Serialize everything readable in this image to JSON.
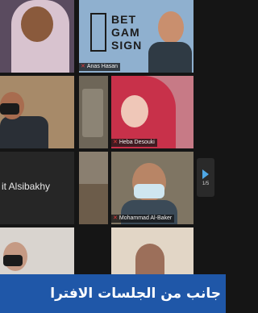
{
  "participants": [
    {
      "name": ""
    },
    {
      "name": "Anas Hasan"
    },
    {
      "name": ""
    },
    {
      "name": ""
    },
    {
      "name": "Heba Desouki"
    },
    {
      "name": "it Alsibakhy"
    },
    {
      "name": "Mohammad Al-Baker"
    },
    {
      "name": ""
    },
    {
      "name": ""
    }
  ],
  "background_logo": {
    "line1": "BET",
    "line2": "GAM",
    "line3": "SIGN"
  },
  "pager": {
    "count": "1/5",
    "icon": "chevron-right-icon"
  },
  "banner": {
    "text": "جانب من الجلسات الافترا"
  },
  "colors": {
    "banner": "#1f57a8",
    "muted_mic": "#e23b3b",
    "pager_accent": "#4fa8e6"
  }
}
